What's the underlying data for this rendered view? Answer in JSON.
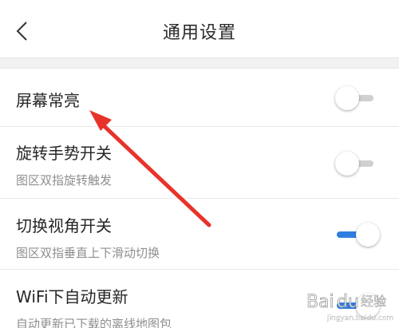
{
  "header": {
    "title": "通用设置",
    "back_icon": "chevron-left-icon"
  },
  "settings": [
    {
      "title": "屏幕常亮",
      "subtitle": "",
      "enabled": false
    },
    {
      "title": "旋转手势开关",
      "subtitle": "图区双指旋转触发",
      "enabled": false
    },
    {
      "title": "切换视角开关",
      "subtitle": "图区双指垂直上下滑动切换",
      "enabled": true
    },
    {
      "title": "WiFi下自动更新",
      "subtitle": "自动更新已下载的离线地图包",
      "enabled": true
    }
  ],
  "colors": {
    "toggle_on": "#2f7de1",
    "toggle_off": "#d0d0d0",
    "arrow": "#e8332b"
  },
  "watermark": {
    "text": "Baidu经验",
    "url": "jingyan.baidu.com"
  }
}
